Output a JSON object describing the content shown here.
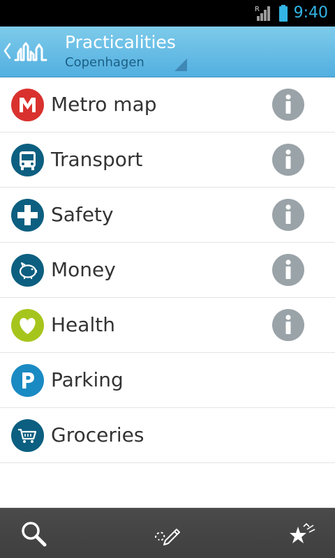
{
  "status_bar": {
    "time": "9:40",
    "roaming_indicator": "R",
    "icons": [
      "signal-roaming-icon",
      "battery-icon"
    ]
  },
  "action_bar": {
    "title": "Practicalities",
    "subtitle": "Copenhagen",
    "icons": [
      "up-chevron-icon",
      "city-skyline-logo-icon",
      "dropdown-triangle-icon"
    ]
  },
  "list": {
    "items": [
      {
        "label": "Metro map",
        "icon": "metro-m-icon",
        "icon_color": "#d9322e",
        "has_info": true
      },
      {
        "label": "Transport",
        "icon": "bus-icon",
        "icon_color": "#0c5f80",
        "has_info": true
      },
      {
        "label": "Safety",
        "icon": "cross-plus-icon",
        "icon_color": "#0c5f80",
        "has_info": true
      },
      {
        "label": "Money",
        "icon": "piggy-bank-icon",
        "icon_color": "#0c5f80",
        "has_info": true
      },
      {
        "label": "Health",
        "icon": "heart-icon",
        "icon_color": "#a6c51c",
        "has_info": true
      },
      {
        "label": "Parking",
        "icon": "parking-p-icon",
        "icon_color": "#1a8ac3",
        "has_info": false
      },
      {
        "label": "Groceries",
        "icon": "shopping-cart-icon",
        "icon_color": "#0c5f80",
        "has_info": false
      }
    ],
    "info_icon": "info-icon",
    "info_color": "#9aa3a8"
  },
  "bottom_bar": {
    "buttons": [
      "search-icon",
      "draw-route-icon",
      "favorites-stars-icon"
    ]
  },
  "colors": {
    "action_bar_top": "#7ecbea",
    "action_bar_bottom": "#52afe0",
    "status_time": "#33b5e5",
    "bottom_bar": "#444444"
  }
}
